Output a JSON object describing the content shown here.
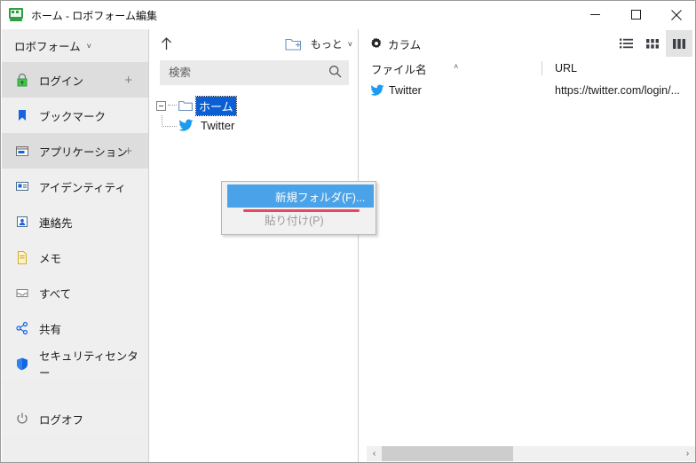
{
  "window": {
    "title": "ホーム - ロボフォーム編集",
    "app_icon": "roboform-icon",
    "buttons": {
      "minimize": "minimize-icon",
      "maximize": "maximize-icon",
      "close": "close-icon"
    }
  },
  "sidebar": {
    "header": {
      "label": "ロボフォーム",
      "caret": "˅"
    },
    "items": [
      {
        "label": "ログイン",
        "icon": "lock-icon",
        "plus": "+",
        "shade": true
      },
      {
        "label": "ブックマーク",
        "icon": "bookmark-icon",
        "plus": "",
        "shade": false
      },
      {
        "label": "アプリケーション",
        "icon": "application-icon",
        "plus": "+",
        "shade": true
      },
      {
        "label": "アイデンティティ",
        "icon": "identity-card-icon",
        "plus": "",
        "shade": false
      },
      {
        "label": "連絡先",
        "icon": "contact-icon",
        "plus": "",
        "shade": false
      },
      {
        "label": "メモ",
        "icon": "note-icon",
        "plus": "",
        "shade": false
      },
      {
        "label": "すべて",
        "icon": "inbox-icon",
        "plus": "",
        "shade": false
      },
      {
        "label": "共有",
        "icon": "share-icon",
        "plus": "",
        "shade": false
      },
      {
        "label": "セキュリティセンター",
        "icon": "shield-icon",
        "plus": "",
        "shade": false
      }
    ],
    "logoff": {
      "label": "ログオフ",
      "icon": "power-icon"
    }
  },
  "tree_pane": {
    "toolbar": {
      "up_icon": "arrow-up-icon",
      "new_folder_icon": "new-folder-icon",
      "more_label": "もっと",
      "more_caret": "˅"
    },
    "search": {
      "value": "",
      "placeholder": "検索",
      "icon": "search-icon"
    },
    "tree": {
      "root": {
        "label": "ホーム",
        "selected": true,
        "expander": "collapse-box",
        "icon": "folder-icon"
      },
      "children": [
        {
          "label": "Twitter",
          "icon": "twitter-icon"
        }
      ]
    }
  },
  "context_menu": {
    "items": [
      {
        "label": "新規フォルダ(F)...",
        "state": "highlighted"
      },
      {
        "label": "貼り付け(P)",
        "state": "disabled"
      }
    ],
    "annotation_color": "#e8485f"
  },
  "list_pane": {
    "toolbar": {
      "columns_label": "カラム",
      "gear_icon": "gear-icon",
      "view_modes": [
        {
          "name": "list-view-icon",
          "active": false
        },
        {
          "name": "tile-view-icon",
          "active": false
        },
        {
          "name": "column-view-icon",
          "active": true
        }
      ]
    },
    "columns": [
      {
        "label": "ファイル名",
        "sort": "˄"
      },
      {
        "label": "URL",
        "sort": ""
      }
    ],
    "rows": [
      {
        "name": "Twitter",
        "icon": "twitter-icon",
        "url": "https://twitter.com/login/..."
      }
    ],
    "scrollbar": {
      "left_arrow": "‹",
      "right_arrow": "›"
    }
  },
  "colors": {
    "selection_blue": "#0a5fd4",
    "menu_highlight": "#4aa3e8",
    "annotation_red": "#e8485f",
    "sidebar_bg": "#eeeeee",
    "sidebar_shade": "#dddddd"
  }
}
